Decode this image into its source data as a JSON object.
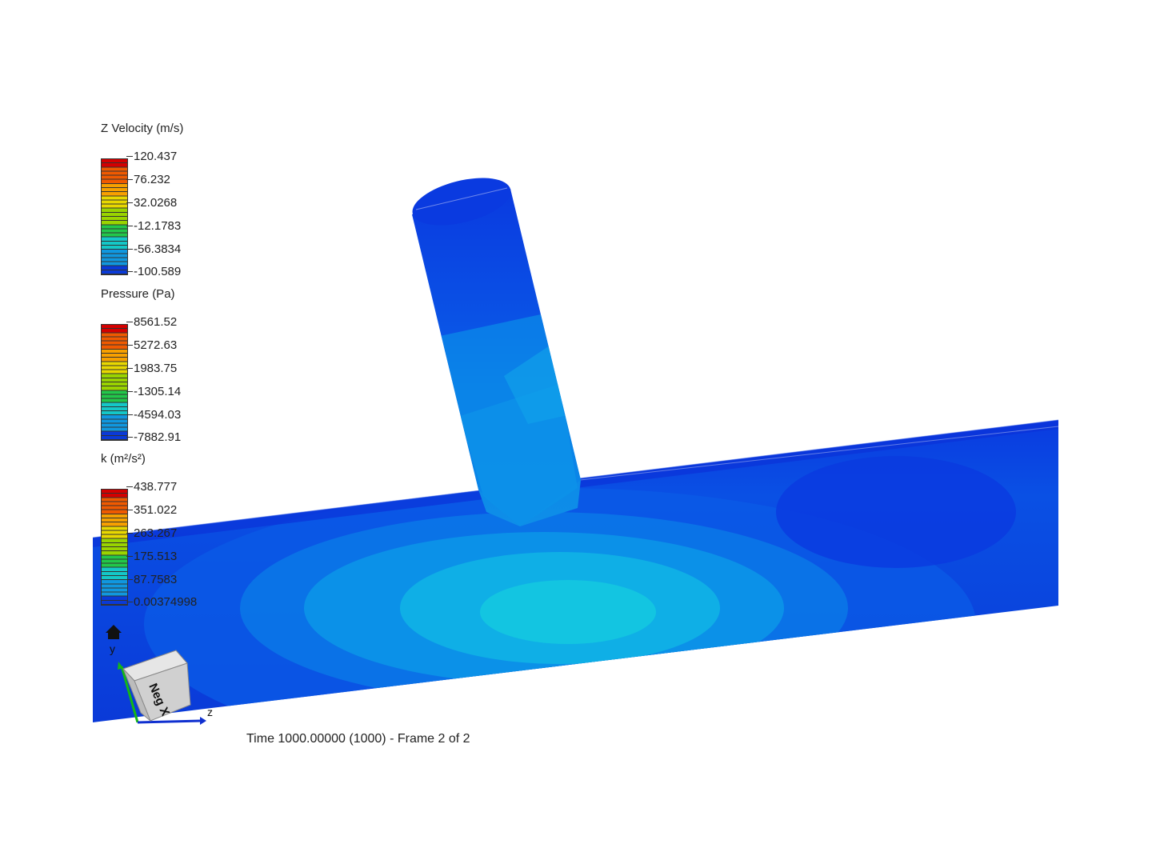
{
  "legends": [
    {
      "title": "Z Velocity (m/s)",
      "labels": [
        "120.437",
        "76.232",
        "32.0268",
        "-12.1783",
        "-56.3834",
        "-100.589"
      ]
    },
    {
      "title": "Pressure (Pa)",
      "labels": [
        "8561.52",
        "5272.63",
        "1983.75",
        "-1305.14",
        "-4594.03",
        "-7882.91"
      ]
    },
    {
      "title": "k (m²/s²)",
      "labels": [
        "438.777",
        "351.022",
        "263.267",
        "175.513",
        "87.7583",
        "0.00374998"
      ]
    }
  ],
  "colormap": [
    "#d40000",
    "#f05a00",
    "#f7a000",
    "#e8d800",
    "#9ad400",
    "#22c84a",
    "#14c8c8",
    "#1098e0",
    "#0a3ad8"
  ],
  "orientation": {
    "cube_face_label": "Neg X",
    "axis_y": "y",
    "axis_z": "z",
    "home_icon": "home-icon"
  },
  "status": {
    "time_text": "Time 1000.00000 (1000) - Frame 2 of 2"
  }
}
